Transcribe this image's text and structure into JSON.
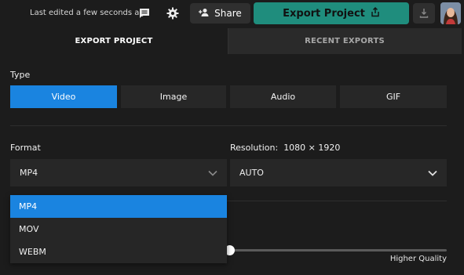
{
  "topbar": {
    "last_edited": "Last edited a few seconds ago",
    "share_label": "Share",
    "export_label": "Export Project",
    "icons": [
      "comment-icon",
      "gear-icon",
      "add-person-icon",
      "share-out-icon",
      "download-icon"
    ]
  },
  "tabs": [
    {
      "label": "EXPORT PROJECT",
      "active": true
    },
    {
      "label": "RECENT EXPORTS",
      "active": false
    }
  ],
  "type_section": {
    "label": "Type",
    "options": [
      "Video",
      "Image",
      "Audio",
      "GIF"
    ],
    "selected": "Video"
  },
  "format": {
    "label": "Format",
    "value": "MP4",
    "options": [
      "MP4",
      "MOV",
      "WEBM"
    ],
    "highlighted": "MP4"
  },
  "resolution": {
    "label": "Resolution:",
    "dims": "1080 × 1920",
    "value": "AUTO"
  },
  "quality": {
    "right_label": "Higher Quality"
  },
  "colors": {
    "accent_blue": "#1a84e0",
    "export_teal": "#1f8d7d",
    "background": "#1c1c1c"
  }
}
